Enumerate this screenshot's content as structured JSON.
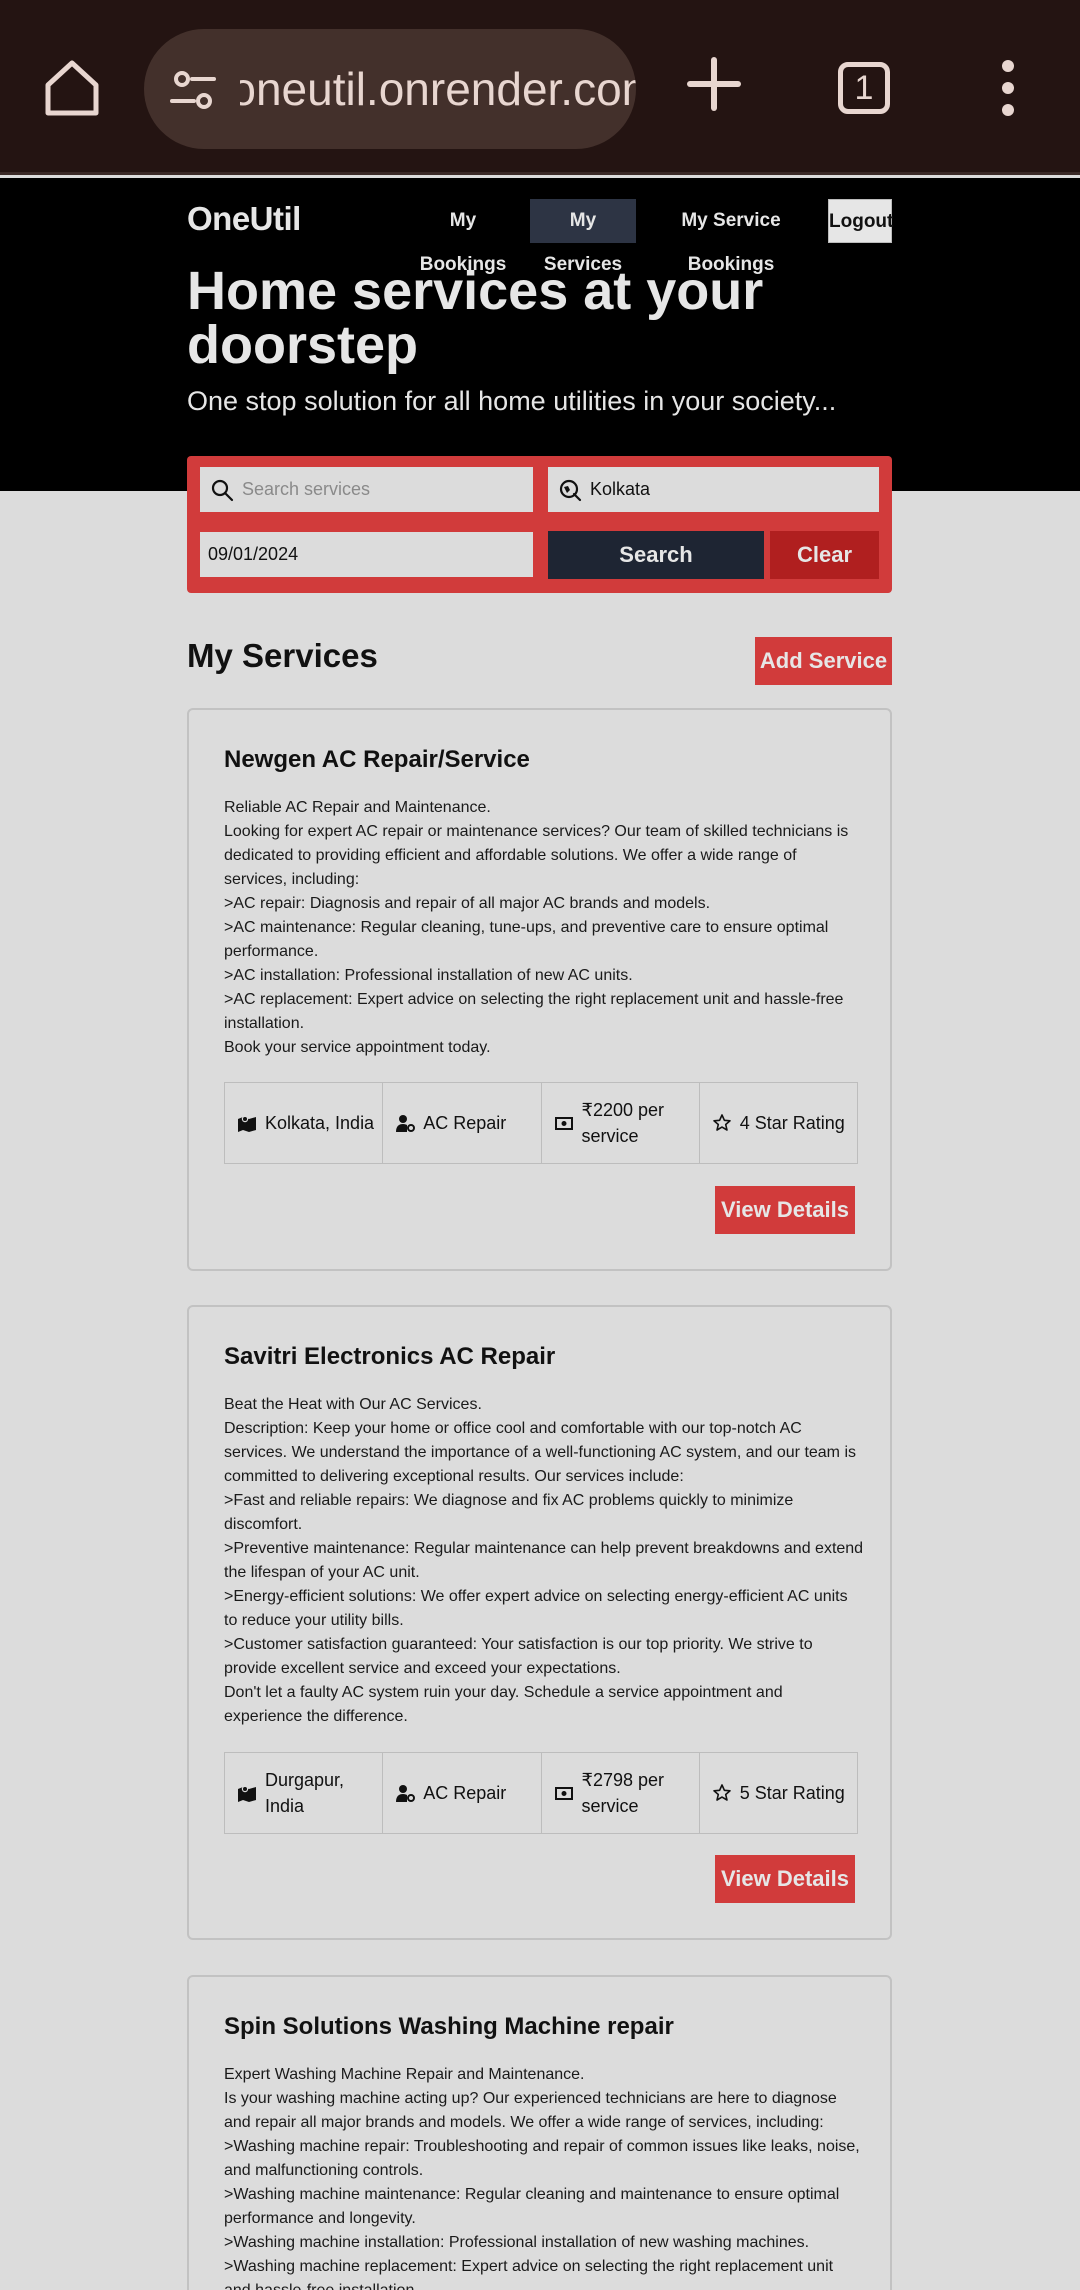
{
  "browser": {
    "url": "oneutil.onrender.com",
    "tab_count": "1"
  },
  "header": {
    "brand": "OneUtil",
    "nav": {
      "my_bookings": "My Bookings",
      "my_services": "My Services",
      "my_service_bookings": "My Service Bookings",
      "logout": "Logout"
    },
    "hero_title": "Home services at your doorstep",
    "hero_subtitle": "One stop solution for all home utilities in your society..."
  },
  "search": {
    "placeholder": "Search services",
    "value": "",
    "location": "Kolkata",
    "date": "09/01/2024",
    "search_label": "Search",
    "clear_label": "Clear"
  },
  "section": {
    "title": "My Services",
    "add_label": "Add Service"
  },
  "services": [
    {
      "title": "Newgen AC Repair/Service",
      "description": [
        "Reliable AC Repair and Maintenance.",
        "Looking for expert AC repair or maintenance services? Our team of skilled technicians is dedicated to providing efficient and affordable solutions. We offer a wide range of services, including:",
        ">AC repair: Diagnosis and repair of all major AC brands and models.",
        ">AC maintenance: Regular cleaning, tune-ups, and preventive care to ensure optimal performance.",
        ">AC installation: Professional installation of new AC units.",
        ">AC replacement: Expert advice on selecting the right replacement unit and hassle-free installation.",
        "Book your service appointment today."
      ],
      "location": "Kolkata, India",
      "category": "AC Repair",
      "price": "₹2200 per service",
      "rating": "4 Star Rating",
      "view_label": "View Details"
    },
    {
      "title": "Savitri Electronics AC Repair",
      "description": [
        "Beat the Heat with Our AC Services.",
        "Description: Keep your home or office cool and comfortable with our top-notch AC services. We understand the importance of a well-functioning AC system, and our team is committed to delivering exceptional results. Our services include:",
        ">Fast and reliable repairs: We diagnose and fix AC problems quickly to minimize discomfort.",
        ">Preventive maintenance: Regular maintenance can help prevent breakdowns and extend the lifespan of your AC unit.",
        ">Energy-efficient solutions: We offer expert advice on selecting energy-efficient AC units to reduce your utility bills.",
        ">Customer satisfaction guaranteed: Your satisfaction is our top priority. We strive to provide excellent service and exceed your expectations.",
        "Don't let a faulty AC system ruin your day. Schedule a service appointment and experience the difference."
      ],
      "location": "Durgapur, India",
      "category": "AC Repair",
      "price": "₹2798 per service",
      "rating": "5 Star Rating",
      "view_label": "View Details"
    },
    {
      "title": "Spin Solutions Washing Machine repair",
      "description": [
        "Expert Washing Machine Repair and Maintenance.",
        "Is your washing machine acting up? Our experienced technicians are here to diagnose and repair all major brands and models. We offer a wide range of services, including:",
        ">Washing machine repair: Troubleshooting and repair of common issues like leaks, noise, and malfunctioning controls.",
        ">Washing machine maintenance: Regular cleaning and maintenance to ensure optimal performance and longevity.",
        ">Washing machine installation: Professional installation of new washing machines.",
        ">Washing machine replacement: Expert advice on selecting the right replacement unit and hassle-free installation."
      ]
    }
  ]
}
